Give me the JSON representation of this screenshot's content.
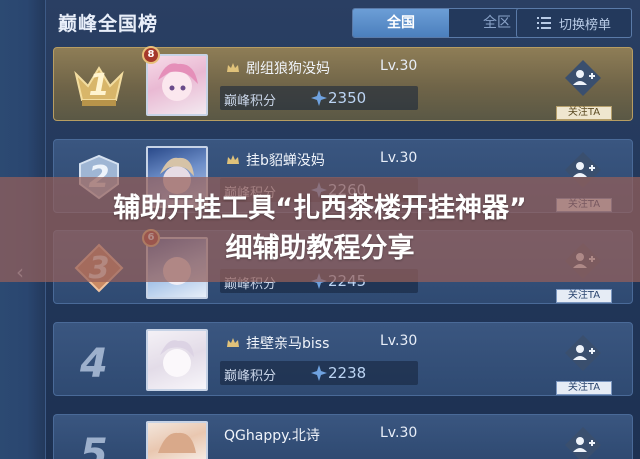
{
  "header": {
    "title": "巅峰全国榜",
    "tabs": [
      {
        "label": "全国",
        "active": true
      },
      {
        "label": "全区",
        "active": false
      }
    ],
    "switch_label": "切换榜单"
  },
  "score_label": "巅峰积分",
  "follow_label": "关注TA",
  "rows": [
    {
      "rank": "1",
      "badge": "8",
      "name": "剧组狼狗没妈",
      "level": "Lv.30",
      "score": "2350"
    },
    {
      "rank": "2",
      "badge": "",
      "name": "挂b貂蝉没妈",
      "level": "Lv.30",
      "score": "2260"
    },
    {
      "rank": "3",
      "badge": "6",
      "name": "",
      "level": "",
      "score": "2245"
    },
    {
      "rank": "4",
      "badge": "",
      "name": "挂壁亲马biss",
      "level": "Lv.30",
      "score": "2238"
    },
    {
      "rank": "5",
      "badge": "",
      "name": "QGhappy.北诗",
      "level": "Lv.30",
      "score": ""
    }
  ],
  "overlay": {
    "title": "辅助开挂工具“扎西茶楼开挂神器”",
    "subtitle": "细辅助教程分享"
  },
  "colors": {
    "gold_medal": "#d8b66a",
    "silver_medal": "#9fb6d4",
    "bronze_medal": "#c98a64",
    "overlay": "#9a5f5a"
  }
}
